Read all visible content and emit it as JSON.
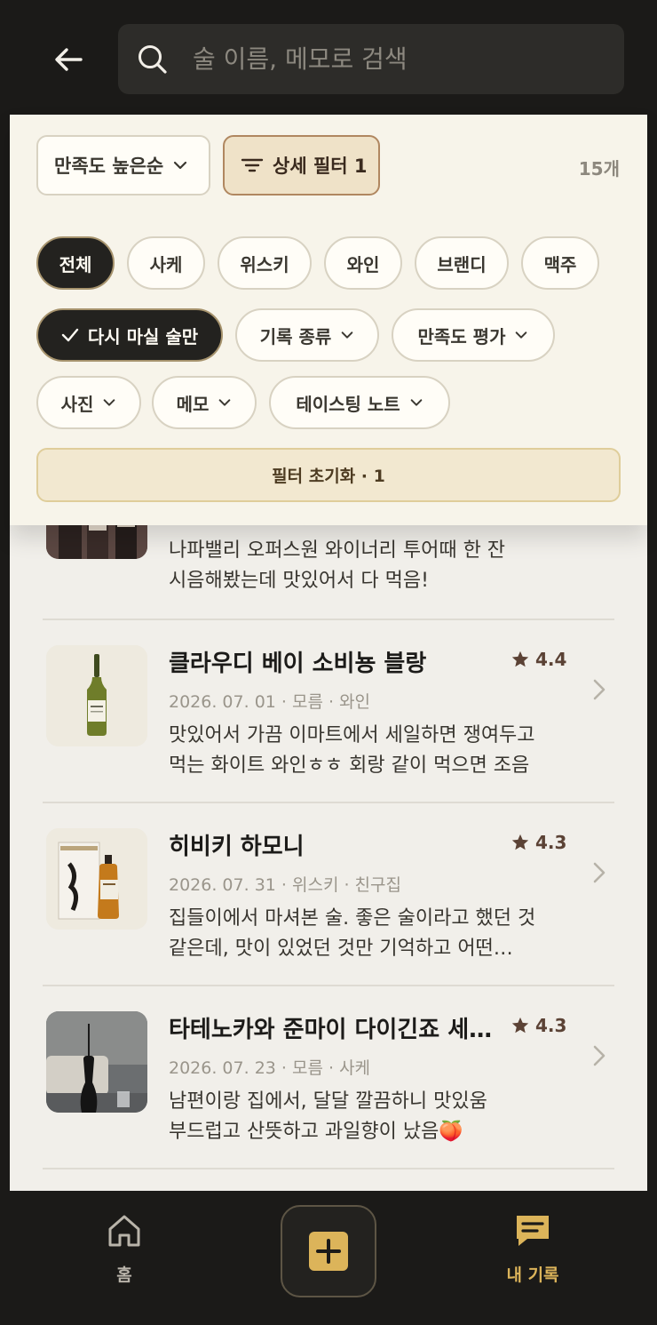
{
  "header": {
    "search_placeholder": "술 이름, 메모로 검색"
  },
  "filters": {
    "sort_label": "만족도 높은순",
    "detail_label": "상세 필터 1",
    "count": "15개",
    "categories": [
      "전체",
      "사케",
      "위스키",
      "와인",
      "브랜디",
      "맥주"
    ],
    "repurchase_label": "다시 마실 술만",
    "record_type_label": "기록 종류",
    "rating_label": "만족도 평가",
    "photo_label": "사진",
    "memo_label": "메모",
    "tasting_label": "테이스팅 노트",
    "reset_label": "필터 초기화 · 1"
  },
  "records": [
    {
      "memo_lines": [
        "나파밸리 오퍼스원 와이너리 투어때 한 잔",
        "시음해봤는데 맛있어서 다 먹음!"
      ]
    },
    {
      "title": "클라우디 베이 소비뇽 블랑",
      "rating": "4.4",
      "meta": "2026. 07. 01 · 모름 · 와인",
      "memo_lines": [
        "맛있어서 가끔 이마트에서 세일하면 쟁여두고",
        "먹는 화이트 와인ㅎㅎ 회랑 같이 먹으면 조음"
      ]
    },
    {
      "title": "히비키 하모니",
      "rating": "4.3",
      "meta": "2026. 07. 31 · 위스키 · 친구집",
      "memo_lines": [
        "집들이에서 마셔본 술. 좋은 술이라고 했던 것",
        "같은데, 맛이 있었던 것만 기억하고 어떤…"
      ]
    },
    {
      "title": "타테노카와 준마이 다이긴죠 세…",
      "rating": "4.3",
      "meta": "2026. 07. 23 · 모름 · 사케",
      "memo_lines": [
        "남편이랑 집에서, 달달 깔끔하니 맛있움",
        "부드럽고 산뜻하고 과일향이 났음🍑"
      ]
    }
  ],
  "nav": {
    "home_label": "홈",
    "records_label": "내 기록"
  },
  "icons": {
    "back": "back-arrow-icon",
    "search": "search-icon",
    "sort_chevron": "chevron-down-icon",
    "filter": "filter-lines-icon",
    "check": "check-icon",
    "star": "star-icon",
    "chevron_right": "chevron-right-icon",
    "home": "home-icon",
    "add": "plus-square-icon",
    "records": "chat-bubble-icon"
  },
  "colors": {
    "accent_gold": "#dcb45a",
    "rating_brown": "#5b4235",
    "panel_bg": "#f7f4ea",
    "active_chip": "#23221f"
  }
}
